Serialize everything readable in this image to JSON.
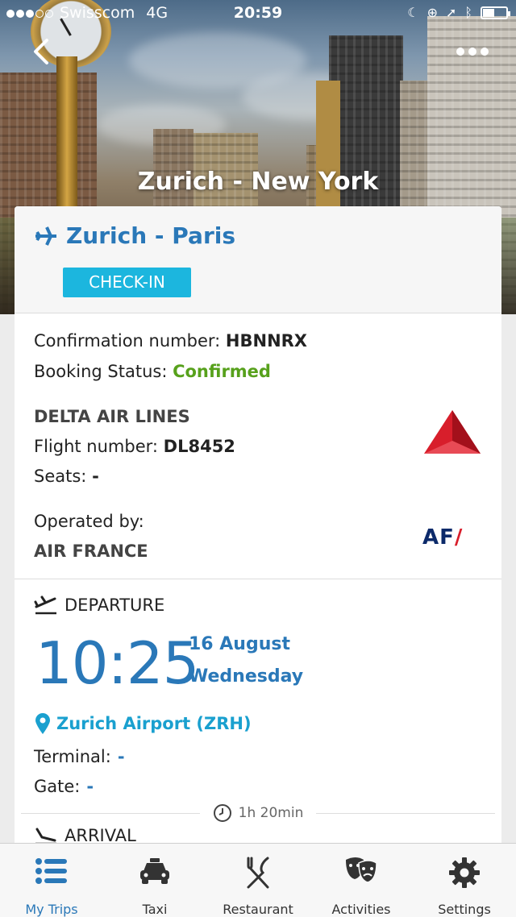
{
  "status_bar": {
    "carrier": "Swisscom",
    "network": "4G",
    "time": "20:59"
  },
  "header": {
    "trip_title": "Zurich - New York"
  },
  "flight": {
    "route": "Zurich - Paris",
    "checkin_label": "CHECK-IN",
    "confirmation_label": "Confirmation number:",
    "confirmation_value": "HBNNRX",
    "status_label": "Booking Status:",
    "status_value": "Confirmed",
    "airline_name": "DELTA AIR LINES",
    "flight_number_label": "Flight number:",
    "flight_number_value": "DL8452",
    "seats_label": "Seats:",
    "seats_value": "-",
    "operated_by_label": "Operated by:",
    "operated_by_value": "AIR FRANCE",
    "operator_logo_text": "AF"
  },
  "departure": {
    "heading": "DEPARTURE",
    "time": "10:25",
    "date": "16 August",
    "weekday": "Wednesday",
    "airport": "Zurich Airport (ZRH)",
    "terminal_label": "Terminal:",
    "terminal_value": "-",
    "gate_label": "Gate:",
    "gate_value": "-",
    "duration": "1h 20min"
  },
  "arrival": {
    "heading": "ARRIVAL"
  },
  "tabbar": {
    "tabs": [
      {
        "label": "My Trips",
        "icon": "list-icon"
      },
      {
        "label": "Taxi",
        "icon": "car-icon"
      },
      {
        "label": "Restaurant",
        "icon": "fork-knife-icon"
      },
      {
        "label": "Activities",
        "icon": "theater-masks-icon"
      },
      {
        "label": "Settings",
        "icon": "gear-icon"
      }
    ]
  },
  "colors": {
    "primary_blue": "#2a78b8",
    "checkin_cyan": "#1cb6de",
    "confirmed_green": "#57a11c",
    "delta_red": "#d81e2b",
    "af_navy": "#0c2a6a"
  }
}
